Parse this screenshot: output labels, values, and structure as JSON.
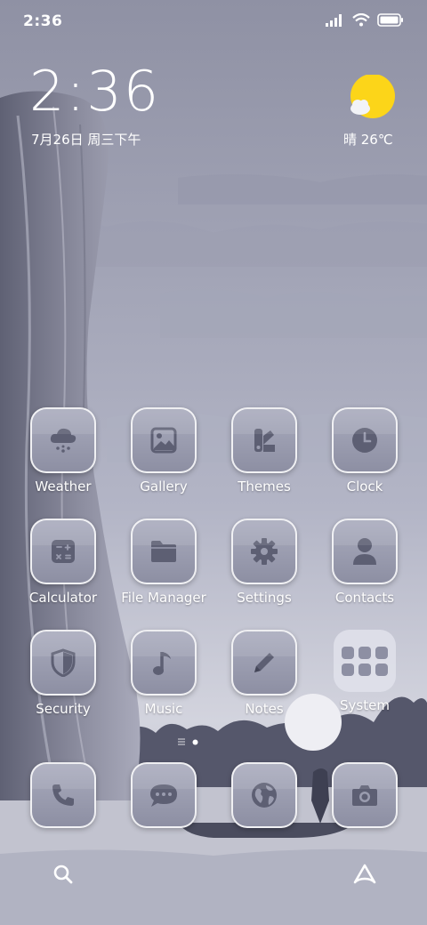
{
  "status_bar": {
    "time": "2:36",
    "icons": [
      "signal-icon",
      "wifi-icon",
      "battery-icon"
    ]
  },
  "clock_widget": {
    "time": "2:36",
    "date": "7月26日 周三下午"
  },
  "weather_widget": {
    "text": "晴 26℃",
    "icon": "sun-cloud-icon"
  },
  "apps": [
    {
      "label": "Weather",
      "icon": "cloud-snow-icon"
    },
    {
      "label": "Gallery",
      "icon": "image-icon"
    },
    {
      "label": "Themes",
      "icon": "palette-icon"
    },
    {
      "label": "Clock",
      "icon": "clock-icon"
    },
    {
      "label": "Calculator",
      "icon": "calculator-icon"
    },
    {
      "label": "File Manager",
      "icon": "folder-icon"
    },
    {
      "label": "Settings",
      "icon": "gear-icon"
    },
    {
      "label": "Contacts",
      "icon": "person-icon"
    },
    {
      "label": "Security",
      "icon": "shield-icon"
    },
    {
      "label": "Music",
      "icon": "music-note-icon"
    },
    {
      "label": "Notes",
      "icon": "pencil-icon"
    },
    {
      "label": "System",
      "icon": "folder-grid-icon"
    }
  ],
  "dock": [
    {
      "icon": "phone-icon"
    },
    {
      "icon": "message-icon"
    },
    {
      "icon": "globe-icon"
    },
    {
      "icon": "camera-icon"
    }
  ],
  "bottom_bar": {
    "left_icon": "search-icon",
    "right_icon": "assistant-icon"
  },
  "colors": {
    "tile": "#9a9caf",
    "glyph": "#5d5f73",
    "sun": "#fcd519",
    "sky": "#b5b7c6"
  }
}
